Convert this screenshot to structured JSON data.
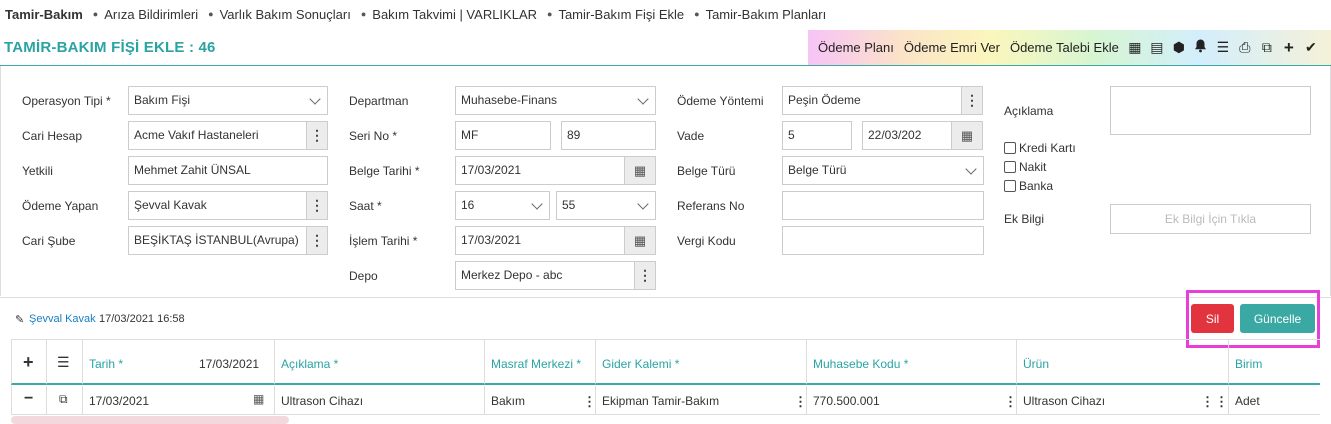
{
  "nav": {
    "items": [
      "Tamir-Bakım",
      "Arıza Bildirimleri",
      "Varlık Bakım Sonuçları",
      "Bakım Takvimi | VARLIKLAR",
      "Tamir-Bakım Fişi Ekle",
      "Tamir-Bakım Planları"
    ]
  },
  "header": {
    "title": "TAMİR-BAKIM FİŞİ EKLE : 46",
    "links": [
      "Ödeme Planı",
      "Ödeme Emri Ver",
      "Ödeme Talebi Ekle"
    ],
    "icons": [
      "table-icon",
      "calculator-icon",
      "box-icon",
      "bell-icon",
      "list-icon",
      "print-icon",
      "copy-icon",
      "plus-icon",
      "check-icon"
    ]
  },
  "form": {
    "operasyon_tipi": {
      "label": "Operasyon Tipi *",
      "value": "Bakım Fişi"
    },
    "cari_hesap": {
      "label": "Cari Hesap",
      "value": "Acme Vakıf Hastaneleri"
    },
    "yetkili": {
      "label": "Yetkili",
      "value": "Mehmet Zahit ÜNSAL"
    },
    "odeme_yapan": {
      "label": "Ödeme Yapan",
      "value": "Şevval Kavak"
    },
    "cari_sube": {
      "label": "Cari Şube",
      "value": "BEŞİKTAŞ İSTANBUL(Avrupa)"
    },
    "departman": {
      "label": "Departman",
      "value": "Muhasebe-Finans"
    },
    "seri_no": {
      "label": "Seri No *",
      "value": "MF",
      "value2": "89"
    },
    "belge_tarihi": {
      "label": "Belge Tarihi *",
      "value": "17/03/2021"
    },
    "saat": {
      "label": "Saat *",
      "hour": "16",
      "minute": "55"
    },
    "islem_tarihi": {
      "label": "İşlem Tarihi *",
      "value": "17/03/2021"
    },
    "depo": {
      "label": "Depo",
      "value": "Merkez Depo - abc"
    },
    "odeme_yontemi": {
      "label": "Ödeme Yöntemi",
      "value": "Peşin Ödeme"
    },
    "vade": {
      "label": "Vade",
      "value": "5",
      "date": "22/03/202"
    },
    "belge_turu": {
      "label": "Belge Türü",
      "value": "Belge Türü"
    },
    "referans_no": {
      "label": "Referans No",
      "value": ""
    },
    "vergi_kodu": {
      "label": "Vergi Kodu",
      "value": ""
    },
    "aciklama": {
      "label": "Açıklama"
    },
    "checkboxes": [
      "Kredi Kartı",
      "Nakit",
      "Banka"
    ],
    "ek_bilgi": {
      "label": "Ek Bilgi",
      "button": "Ek Bilgi İçin Tıkla"
    }
  },
  "audit": {
    "user": "Şevval Kavak",
    "timestamp": "17/03/2021 16:58"
  },
  "actions": {
    "delete": "Sil",
    "update": "Güncelle"
  },
  "colors": {
    "teal": "#3aa8a3",
    "danger": "#e1343f",
    "highlight": "#e83fd8"
  },
  "table": {
    "headers": {
      "tarih": "Tarih *",
      "tarih_value": "17/03/2021",
      "aciklama": "Açıklama *",
      "masraf": "Masraf Merkezi *",
      "gider": "Gider Kalemi *",
      "muhasebe": "Muhasebe Kodu *",
      "urun": "Ürün",
      "birim": "Birim"
    },
    "row": {
      "tarih": "17/03/2021",
      "aciklama": "Ultrason Cihazı",
      "masraf": "Bakım",
      "gider": "Ekipman Tamir-Bakım",
      "muhasebe": "770.500.001",
      "urun": "Ultrason Cihazı",
      "birim": "Adet"
    }
  }
}
